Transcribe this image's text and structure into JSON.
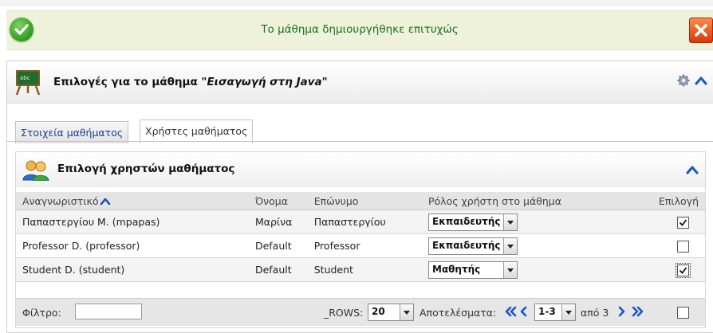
{
  "message": {
    "text": "Το μάθημα δημιουργήθηκε επιτυχώς",
    "colors": {
      "success": "#2f9b1e",
      "close": "#d63a0d"
    }
  },
  "panel": {
    "title_prefix": "Επιλογές για το μάθημα ",
    "course_name": "\"Εισαγωγή στη Java\""
  },
  "tabs": [
    {
      "label": "Στοιχεία μαθήματος",
      "active": false
    },
    {
      "label": "Χρήστες μαθήματος",
      "active": true
    }
  ],
  "section": {
    "title": "Επιλογή χρηστών μαθήματος"
  },
  "table": {
    "headers": [
      "Αναγνωριστικό",
      "Όνομα",
      "Επώνυμο",
      "Ρόλος χρήστη στο μάθημα",
      "Επιλογή"
    ],
    "rows": [
      {
        "id": "Παπαστεργίου Μ. (mpapas)",
        "first": "Μαρίνα",
        "last": "Παπαστεργίου",
        "role": "Εκπαιδευτής",
        "selected": true
      },
      {
        "id": "Professor D. (professor)",
        "first": "Default",
        "last": "Professor",
        "role": "Εκπαιδευτής",
        "selected": false
      },
      {
        "id": "Student D. (student)",
        "first": "Default",
        "last": "Student",
        "role": "Μαθητής",
        "selected": true
      }
    ]
  },
  "footer": {
    "filter_label": "Φίλτρο:",
    "filter_value": "",
    "rows_label": "_ROWS:",
    "rows_value": "20",
    "results_label": "Αποτελέσματα:",
    "page_value": "1-3",
    "of_label": "από 3"
  }
}
